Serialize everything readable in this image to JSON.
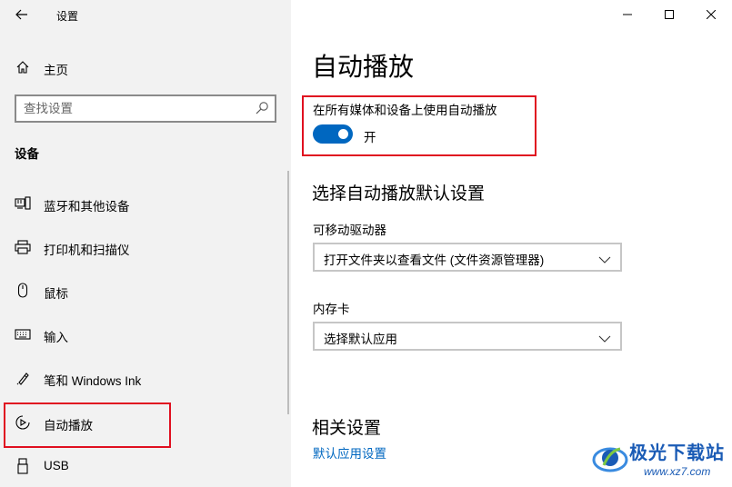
{
  "window": {
    "title": "设置"
  },
  "sidebar": {
    "home_label": "主页",
    "search_placeholder": "查找设置",
    "section_title": "设备",
    "items": [
      {
        "label": "蓝牙和其他设备",
        "icon": "bluetooth-devices-icon"
      },
      {
        "label": "打印机和扫描仪",
        "icon": "printer-icon"
      },
      {
        "label": "鼠标",
        "icon": "mouse-icon"
      },
      {
        "label": "输入",
        "icon": "keyboard-icon"
      },
      {
        "label": "笔和 Windows Ink",
        "icon": "pen-icon"
      },
      {
        "label": "自动播放",
        "icon": "autoplay-icon",
        "selected": true
      },
      {
        "label": "USB",
        "icon": "usb-icon"
      }
    ]
  },
  "main": {
    "title": "自动播放",
    "toggle": {
      "label": "在所有媒体和设备上使用自动播放",
      "state": "开",
      "on": true
    },
    "defaults_heading": "选择自动播放默认设置",
    "removable": {
      "label": "可移动驱动器",
      "value": "打开文件夹以查看文件 (文件资源管理器)"
    },
    "memory_card": {
      "label": "内存卡",
      "value": "选择默认应用"
    },
    "related_heading": "相关设置",
    "related_link": "默认应用设置"
  },
  "watermark": {
    "name": "极光下载站",
    "url": "www.xz7.com"
  },
  "colors": {
    "accent": "#0067c0",
    "highlight_box": "#e01020",
    "sidebar_bg": "#f2f2f2"
  }
}
